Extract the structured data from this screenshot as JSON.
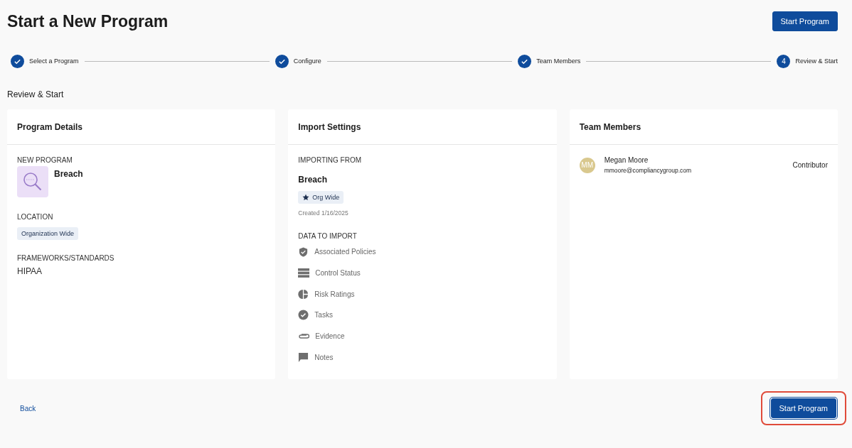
{
  "page": {
    "title": "Start a New Program",
    "primary_action": "Start Program"
  },
  "steps": [
    {
      "label": "Select a Program",
      "completed": true
    },
    {
      "label": "Configure",
      "completed": true
    },
    {
      "label": "Team Members",
      "completed": true
    },
    {
      "label": "Review & Start",
      "completed": false,
      "number": "4"
    }
  ],
  "section_title": "Review & Start",
  "program_details": {
    "title": "Program Details",
    "new_program_label": "NEW PROGRAM",
    "program_name": "Breach",
    "location_label": "LOCATION",
    "location": "Organization Wide",
    "frameworks_label": "FRAMEWORKS/STANDARDS",
    "framework": "HIPAA"
  },
  "import_settings": {
    "title": "Import Settings",
    "importing_from_label": "IMPORTING FROM",
    "source_name": "Breach",
    "scope": "Org Wide",
    "created": "Created 1/16/2025",
    "data_label": "DATA TO IMPORT",
    "items": [
      {
        "label": "Associated Policies",
        "kind": "shield"
      },
      {
        "label": "Control Status",
        "kind": "rows"
      },
      {
        "label": "Risk Ratings",
        "kind": "pie"
      },
      {
        "label": "Tasks",
        "kind": "check"
      },
      {
        "label": "Evidence",
        "kind": "clip"
      },
      {
        "label": "Notes",
        "kind": "note"
      }
    ]
  },
  "team_members": {
    "title": "Team Members",
    "members": [
      {
        "initials": "MM",
        "name": "Megan Moore",
        "email": "mmoore@compliancygroup.com",
        "role": "Contributor",
        "color": "#d9c88e"
      }
    ]
  },
  "footer": {
    "back": "Back",
    "primary_action": "Start Program",
    "highlighted": true
  }
}
